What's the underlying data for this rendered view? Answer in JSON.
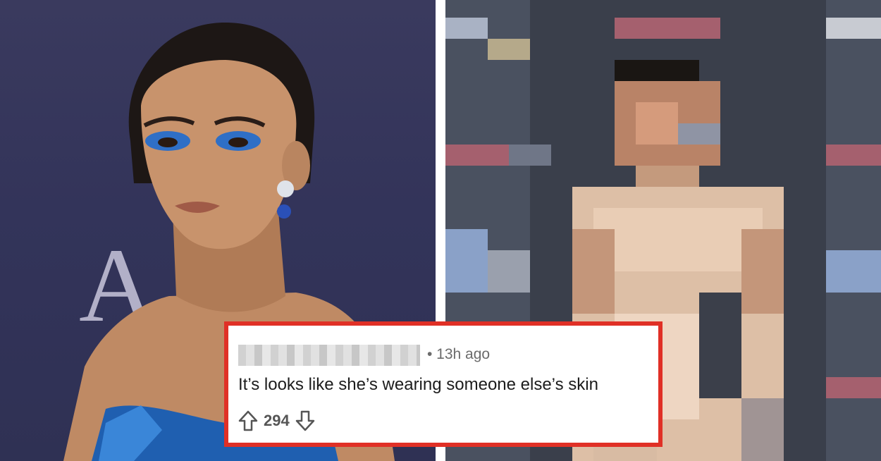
{
  "left_photo": {
    "background_text": "A",
    "colors": {
      "backdrop": "#33345a",
      "skin": "#c8936c",
      "hair": "#1d1715",
      "eyeshadow": "#2f6fc6",
      "gown": "#1f5fb0"
    }
  },
  "right_photo": {
    "pixelated": true,
    "colors": {
      "backdrop": "#3a3f4b",
      "skin": "#e4c6ae",
      "accent": "#a5606e"
    }
  },
  "comment": {
    "timestamp": "• 13h ago",
    "text": "It’s looks like she’s wearing someone else’s skin",
    "upvotes": "294",
    "border_color": "#e03026"
  }
}
